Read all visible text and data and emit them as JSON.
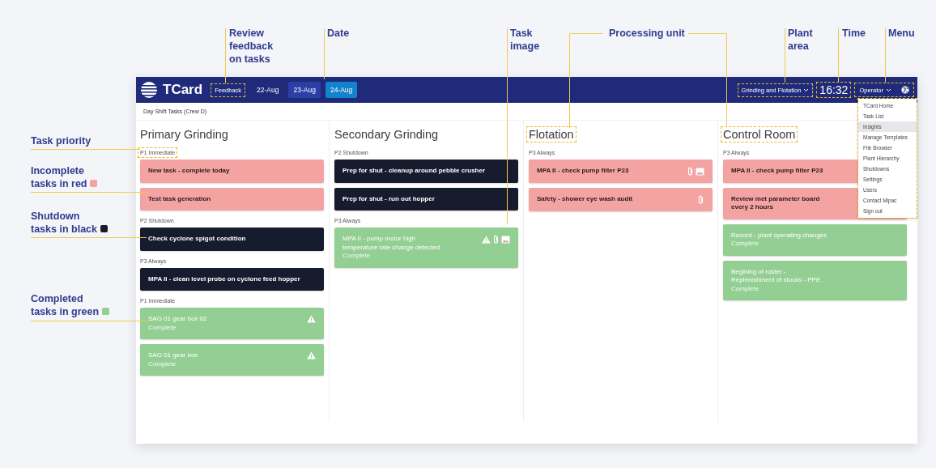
{
  "annotations_top": [
    {
      "text": "Review feedback on tasks"
    },
    {
      "text": "Date"
    },
    {
      "text": "Task image"
    },
    {
      "text": "Processing unit"
    },
    {
      "text": "Plant area"
    },
    {
      "text": "Time"
    },
    {
      "text": "Menu"
    }
  ],
  "annotations_left": [
    {
      "text": "Task priority"
    },
    {
      "text": "Incomplete\ntasks in red",
      "color": "#f4a3a3"
    },
    {
      "text": "Shutdown\ntasks in black",
      "color": "#171b2e"
    },
    {
      "text": "Completed\ntasks in green",
      "color": "#93cf93"
    }
  ],
  "header": {
    "brand": "TCard",
    "feedback": "Feedback",
    "plant_area": "Grinding and Flotation",
    "time": "16:32",
    "user": "Operator",
    "dates": [
      {
        "label": "22-Aug",
        "kind": "plain",
        "selected": false
      },
      {
        "label": "23-Aug",
        "kind": "boxed",
        "selected": false
      },
      {
        "label": "24-Aug",
        "kind": "boxed",
        "selected": true
      }
    ]
  },
  "subheader": "Day Shift Tasks (Crew D)",
  "menu": {
    "items": [
      {
        "label": "TCard Home",
        "selected": false
      },
      {
        "label": "Task List",
        "selected": false
      },
      {
        "label": "Insights",
        "selected": true
      },
      {
        "label": "Manage Templates",
        "selected": false
      },
      {
        "label": "File Browser",
        "selected": false
      },
      {
        "label": "Plant Hierarchy",
        "selected": false
      },
      {
        "label": "Shutdowns",
        "selected": false
      },
      {
        "label": "Settings",
        "selected": false
      },
      {
        "label": "Users",
        "selected": false
      },
      {
        "label": "Contact Mipac",
        "selected": false
      },
      {
        "label": "Sign out",
        "selected": false
      }
    ]
  },
  "columns": [
    {
      "title": "Primary Grinding",
      "callout": false,
      "groups": [
        {
          "priority": "P1 Immediate",
          "callout": true,
          "tasks": [
            {
              "title": "New task - complete today",
              "kind": "incomplete"
            },
            {
              "title": "Test task generation",
              "kind": "incomplete"
            }
          ]
        },
        {
          "priority": "P2 Shutdown",
          "callout": false,
          "tasks": [
            {
              "title": "Check cyclone spigot condition",
              "kind": "shutdown"
            }
          ]
        },
        {
          "priority": "P3 Always",
          "callout": false,
          "tasks": [
            {
              "title": "MPA II - clean level probe on cyclone feed hopper",
              "kind": "shutdown"
            }
          ]
        },
        {
          "priority": "P1 Immediate",
          "callout": false,
          "tasks": [
            {
              "title": "SAG 01 gear box 02",
              "kind": "complete",
              "note": "Complete",
              "icons": [
                {
                  "kind": "warning"
                }
              ]
            },
            {
              "title": "SAG 01 gear box",
              "kind": "complete",
              "note": "Complete",
              "icons": [
                {
                  "kind": "warning"
                }
              ]
            }
          ]
        }
      ]
    },
    {
      "title": "Secondary Grinding",
      "callout": false,
      "groups": [
        {
          "priority": "P2 Shutdown",
          "callout": false,
          "tasks": [
            {
              "title": "Prep for shut - cleanup around pebble crusher",
              "kind": "shutdown"
            },
            {
              "title": "Prep for shut - run out hopper",
              "kind": "shutdown"
            }
          ]
        },
        {
          "priority": "P3 Always",
          "callout": false,
          "tasks": [
            {
              "title": "MPA II - pump motor high\ntemperature rate change detected",
              "kind": "complete",
              "note": "Complete",
              "icons": [
                {
                  "kind": "warning"
                },
                {
                  "kind": "attachment"
                },
                {
                  "kind": "image"
                }
              ]
            }
          ]
        }
      ]
    },
    {
      "title": "Flotation",
      "callout": true,
      "groups": [
        {
          "priority": "P3 Always",
          "callout": false,
          "tasks": [
            {
              "title": "MPA II - check pump filter P23",
              "kind": "incomplete",
              "icons": [
                {
                  "kind": "attachment"
                },
                {
                  "kind": "image"
                }
              ]
            },
            {
              "title": "Safety - shower eye wash audit",
              "kind": "incomplete",
              "icons": [
                {
                  "kind": "attachment"
                }
              ]
            }
          ]
        }
      ]
    },
    {
      "title": "Control Room",
      "callout": true,
      "groups": [
        {
          "priority": "P3 Always",
          "callout": false,
          "tasks": [
            {
              "title": "MPA II - check pump filter P23",
              "kind": "incomplete"
            },
            {
              "title": "Review met parameter board\nevery 2 hours",
              "kind": "incomplete"
            },
            {
              "title": "Record - plant operating changes",
              "kind": "complete",
              "note": "Complete"
            },
            {
              "title": "Begining of roster -\nReplenishment of stocks - PPE",
              "kind": "complete",
              "note": "Complete"
            }
          ]
        }
      ]
    }
  ]
}
